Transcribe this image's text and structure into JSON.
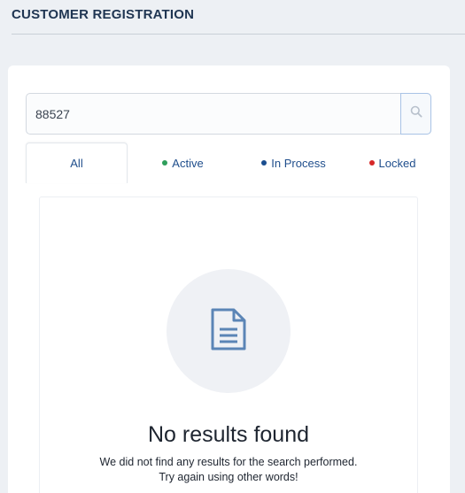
{
  "header": {
    "title": "CUSTOMER REGISTRATION"
  },
  "search": {
    "value": "88527",
    "icon": "search-icon"
  },
  "tabs": [
    {
      "label": "All",
      "selected": true,
      "dot_color": null
    },
    {
      "label": "Active",
      "selected": false,
      "dot_color": "#2e9e5b"
    },
    {
      "label": "In Process",
      "selected": false,
      "dot_color": "#1a4d8f"
    },
    {
      "label": "Locked",
      "selected": false,
      "dot_color": "#d62828"
    }
  ],
  "empty_state": {
    "icon": "document-icon",
    "title": "No results found",
    "line1": "We did not find any results for the search performed.",
    "line2": "Try again using other words!"
  },
  "colors": {
    "accent": "#1f4e8c",
    "icon": "#5b85b6",
    "background": "#edf0f4"
  }
}
